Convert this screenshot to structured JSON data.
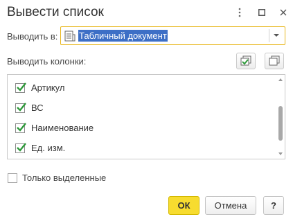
{
  "window": {
    "title": "Вывести список"
  },
  "output_to": {
    "label": "Выводить в:",
    "value": "Табличный документ"
  },
  "columns": {
    "label": "Выводить колонки:",
    "items": [
      {
        "label": "Артикул",
        "checked": true
      },
      {
        "label": "ВС",
        "checked": true
      },
      {
        "label": "Наименование",
        "checked": true
      },
      {
        "label": "Ед. изм.",
        "checked": true
      }
    ]
  },
  "only_selected": {
    "label": "Только выделенные",
    "checked": false
  },
  "buttons": {
    "ok": "ОК",
    "cancel": "Отмена",
    "help": "?"
  },
  "colors": {
    "accent_yellow": "#f7dc2f",
    "check_green": "#2e9a3a",
    "selection_blue": "#3d6fc6",
    "combo_border": "#e8b71d"
  }
}
